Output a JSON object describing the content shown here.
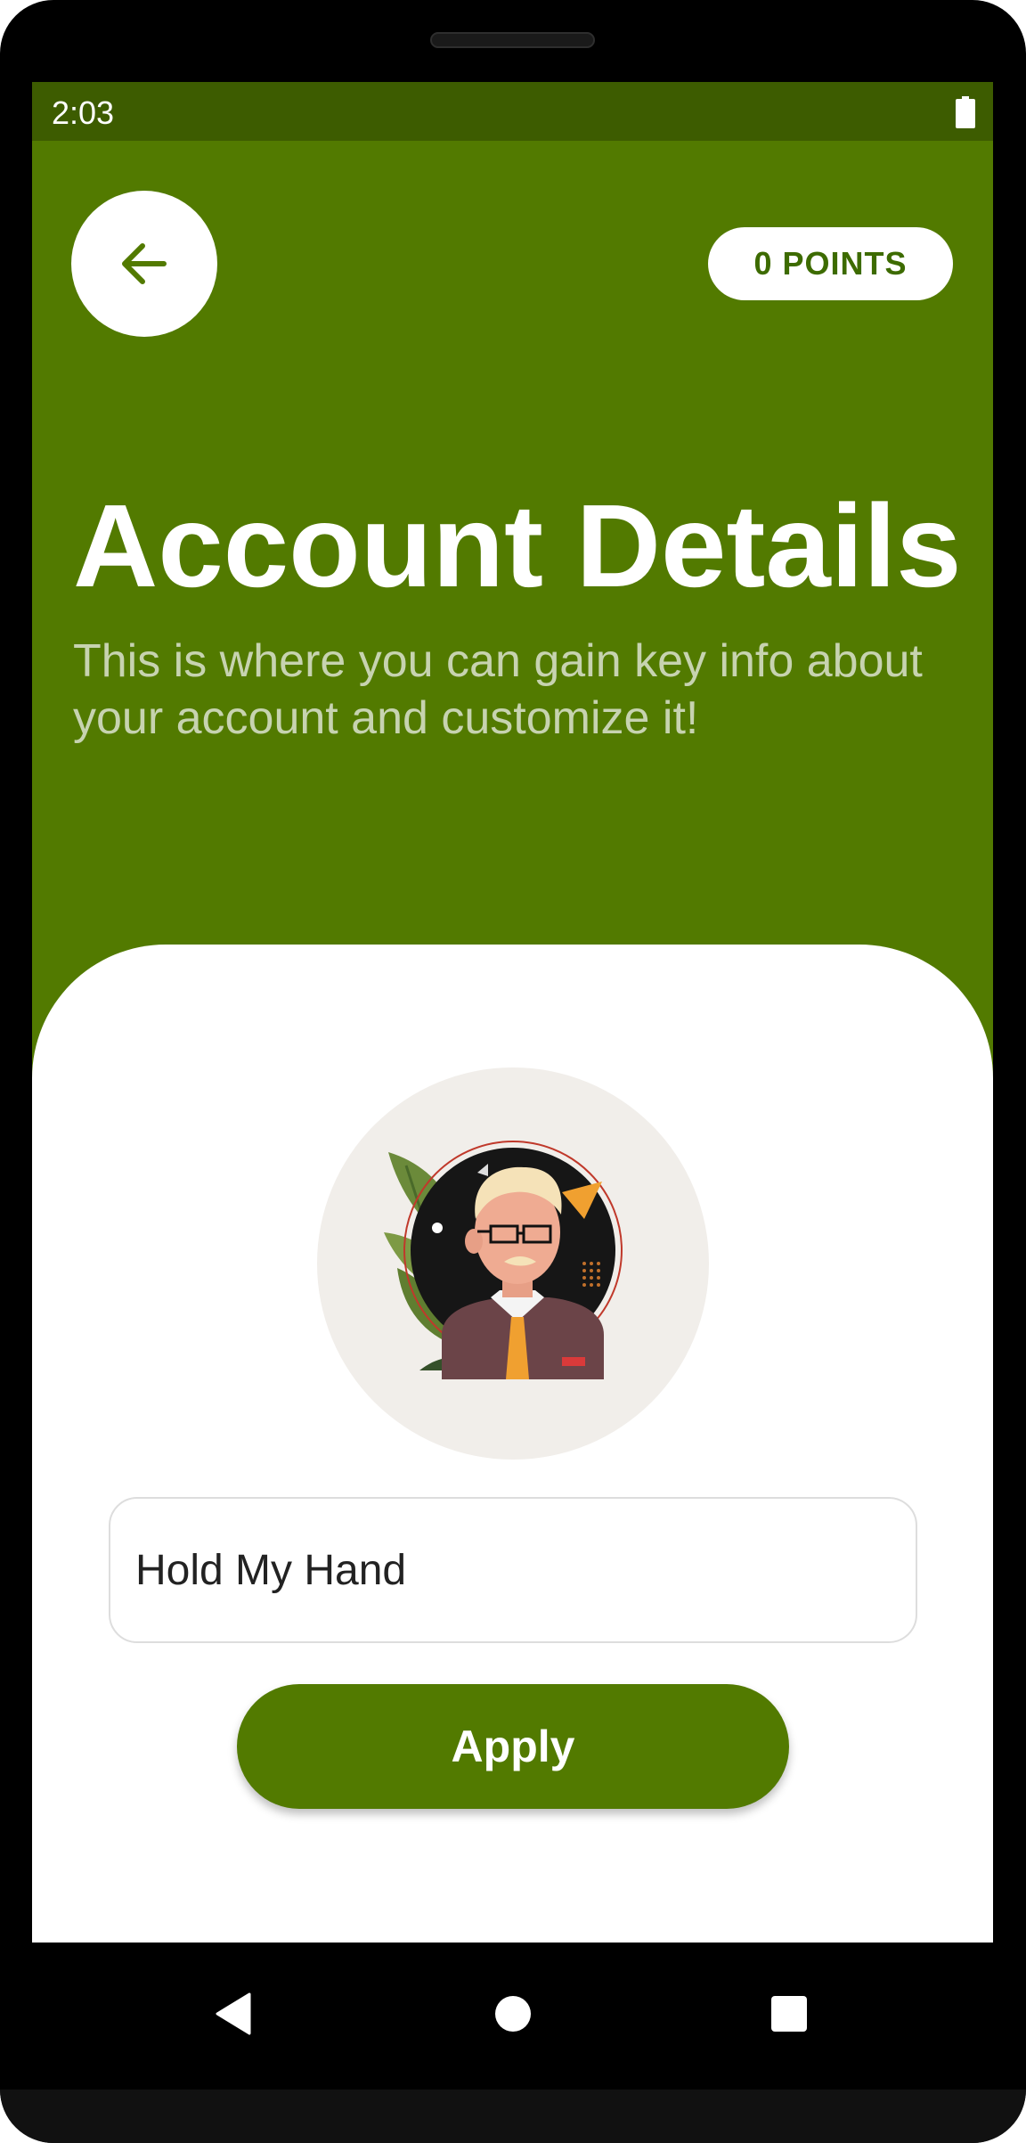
{
  "status_bar": {
    "time": "2:03",
    "battery_icon": "battery-full-icon"
  },
  "header": {
    "back_icon": "arrow-left-icon",
    "points_label": "0 POINTS",
    "title": "Account Details",
    "subtitle": "This is where you can gain key info about your account and customize it!"
  },
  "profile": {
    "avatar_icon": "avatar-illustration",
    "name_value": "Hold My Hand",
    "apply_label": "Apply"
  },
  "nav": {
    "back_icon": "nav-back-triangle-icon",
    "home_icon": "nav-home-circle-icon",
    "recents_icon": "nav-recents-square-icon"
  },
  "colors": {
    "primary": "#527a00",
    "status_bar": "#3d5c00",
    "subtitle": "#c7d3b0",
    "avatar_bg": "#f1eeea"
  }
}
